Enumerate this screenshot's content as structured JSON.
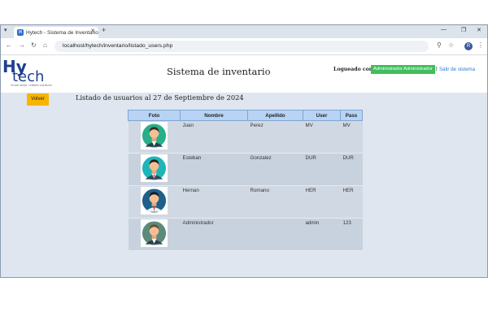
{
  "browser": {
    "tab_title": "Hytech - Sistema de Inventario",
    "url": "localhost/hytech/inventario/listado_users.php",
    "profile_initial": "R"
  },
  "header": {
    "logo_hy": "Hy",
    "logo_tech": "tech",
    "logo_slogan": "Smart ideas, reliable solutions",
    "app_title": "Sistema de inventario",
    "logged_label": "Logueado como:",
    "user_badge": "Administrador Administrador",
    "separator": "|",
    "logout_label": "Salir de sistema"
  },
  "main": {
    "back_label": "Volver",
    "list_title": "Listado de usuarios al 27 de Septiembre de 2024"
  },
  "table": {
    "headers": [
      "Foto",
      "Nombre",
      "Apellido",
      "User",
      "Pass"
    ],
    "rows": [
      {
        "nombre": "Juan",
        "apellido": "Perez",
        "user": "MV",
        "pass": "MV"
      },
      {
        "nombre": "Esteban",
        "apellido": "Gonzalez",
        "user": "DUR",
        "pass": "DUR"
      },
      {
        "nombre": "Hernan",
        "apellido": "Romano",
        "user": "HER",
        "pass": "HER"
      },
      {
        "nombre": "Administrador",
        "apellido": "",
        "user": "admin",
        "pass": "123"
      }
    ]
  },
  "colors": {
    "accent_green": "#3fbf5c",
    "button_yellow": "#f7b500",
    "header_blue": "#b8d3f4",
    "link_blue": "#2a7ad8"
  }
}
